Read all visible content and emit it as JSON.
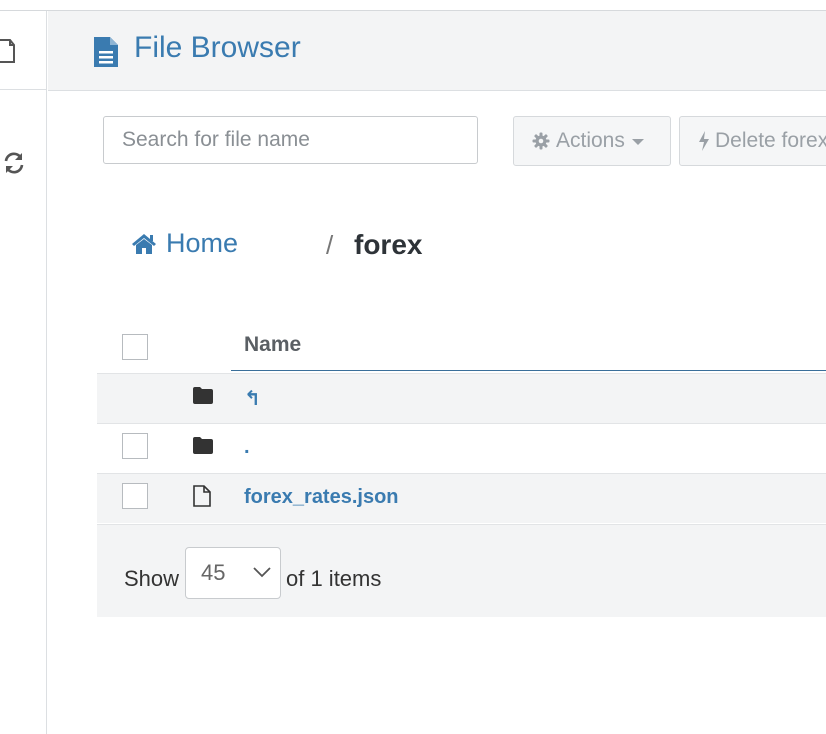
{
  "app": {
    "title": "File Browser"
  },
  "toolbar": {
    "search_placeholder": "Search for file name",
    "actions_label": "Actions",
    "delete_label": "Delete forex"
  },
  "breadcrumb": {
    "home_label": "Home",
    "separator": "/",
    "current": "forex"
  },
  "table": {
    "columns": [
      "Name"
    ],
    "rows": [
      {
        "type": "folder",
        "name": "↰"
      },
      {
        "type": "folder",
        "name": "."
      },
      {
        "type": "file",
        "name": "forex_rates.json"
      }
    ]
  },
  "pagination": {
    "show_label": "Show",
    "page_size": "45",
    "items_label": "of 1 items"
  },
  "colors": {
    "accent": "#3a7bb0",
    "header_bg": "#f3f4f5",
    "text_dark": "#2e3338"
  },
  "icons": {
    "sidebar": [
      "files-icon",
      "refresh-icon"
    ],
    "header": "file-icon",
    "breadcrumb": "home-icon",
    "actions": "gear-icon",
    "delete": "bolt-icon"
  }
}
